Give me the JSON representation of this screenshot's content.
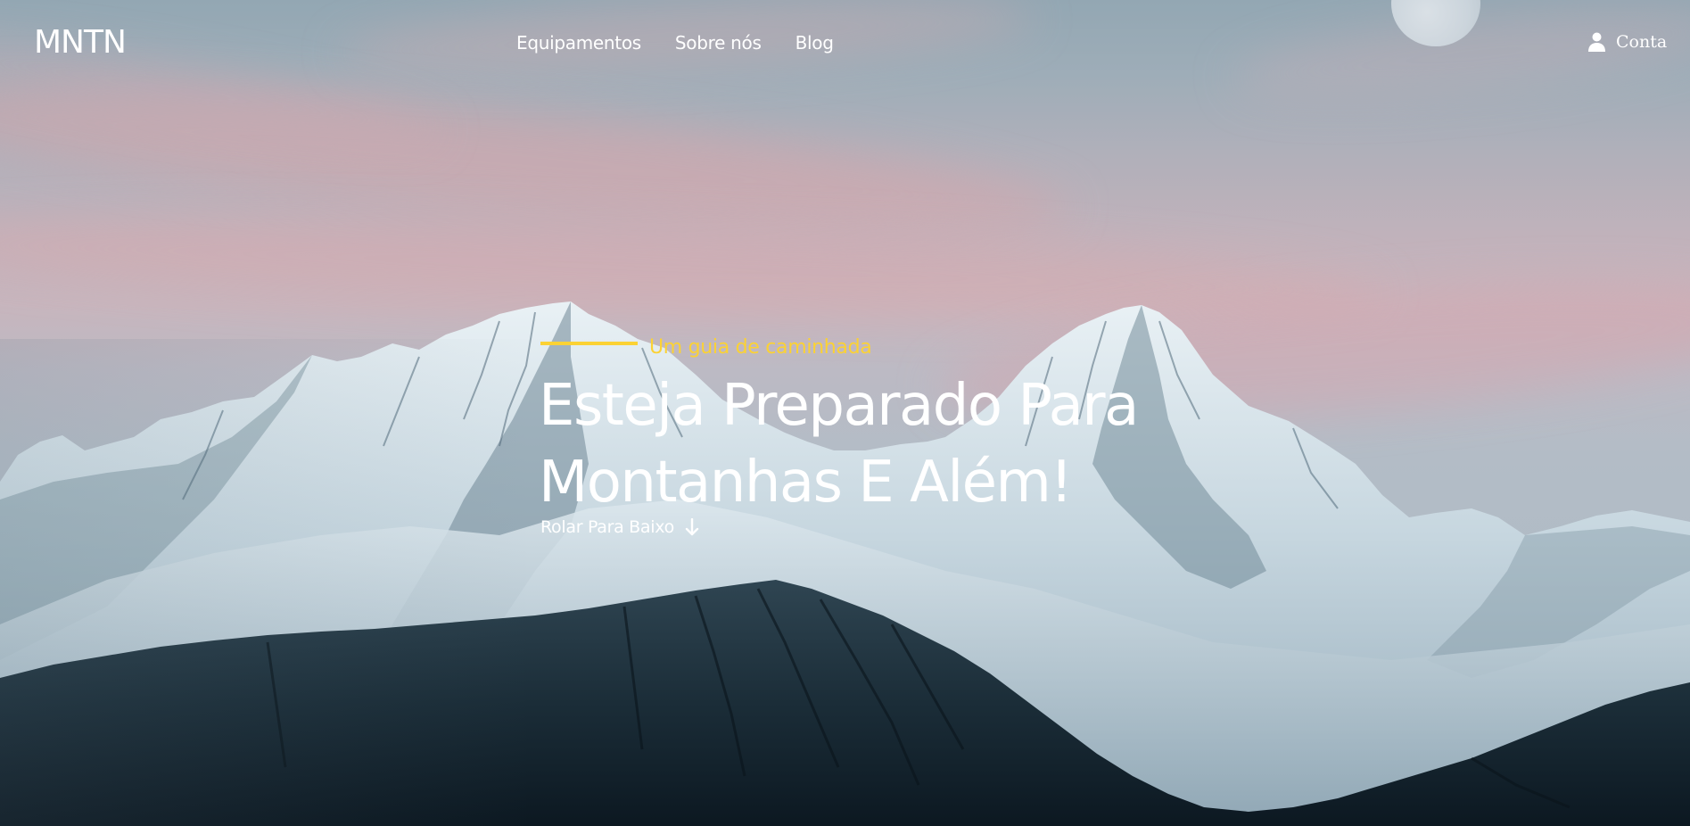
{
  "brand": {
    "logo_text": "MNTN"
  },
  "nav": {
    "items": [
      {
        "label": "Equipamentos"
      },
      {
        "label": "Sobre nós"
      },
      {
        "label": "Blog"
      }
    ]
  },
  "account": {
    "label": "Conta",
    "icon": "user-icon"
  },
  "hero": {
    "eyebrow": "Um guia de caminhada",
    "headline_line1": "Esteja Preparado Para",
    "headline_line2": "Montanhas E Além!",
    "scroll_label": "Rolar Para Baixo",
    "scroll_icon": "arrow-down-icon"
  },
  "colors": {
    "accent": "#fbd234",
    "text": "#ffffff",
    "sky": "#aab9c3",
    "forest": "#0e1b24"
  }
}
